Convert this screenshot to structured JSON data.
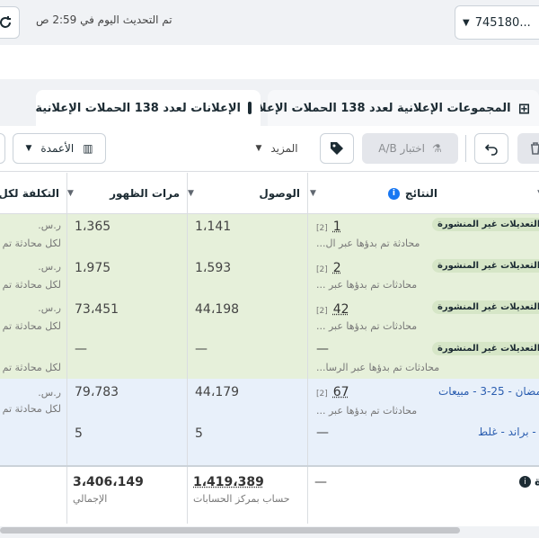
{
  "header": {
    "updated_text": "تم التحديث اليوم في 2:59 ص",
    "account_label": "745180..."
  },
  "tabs": {
    "ads": "الإعلانات لعدد 138 الحملات الإعلانية",
    "adsets": "المجموعات الإعلانية لعدد 138 الحملات الإعلانية"
  },
  "toolbar": {
    "ab_test": "اختبار A/B",
    "more": "المزيد",
    "columns": "الأعمدة"
  },
  "columns": {
    "results": "النتائج",
    "reach": "الوصول",
    "impressions": "مرات الظهور",
    "cost": "التكلفة لكل نتي"
  },
  "badge_text": "التعديلات غير المنشورة",
  "rows": [
    {
      "result": "1",
      "result_sub": "محادثة تم بدؤها عبر ال...",
      "reach": "1،141",
      "impressions": "1،365",
      "cost": "ر.س.",
      "cost_sub": "لكل محادثة تم بد"
    },
    {
      "result": "2",
      "result_sub": "محادثات تم بدؤها عبر ...",
      "reach": "1،593",
      "impressions": "1،975",
      "cost": "ر.س.",
      "cost_sub": "لكل محادثة تم بد"
    },
    {
      "result": "42",
      "result_sub": "محادثات تم بدؤها عبر ...",
      "reach": "44،198",
      "impressions": "73،451",
      "cost": "ر.س.",
      "cost_sub": "لكل محادثة تم بد"
    },
    {
      "result": "—",
      "result_sub": "محادثات تم بدؤها عبر الرسا...",
      "reach": "—",
      "impressions": "—",
      "cost": "",
      "cost_sub": "لكل محادثة تم بد"
    },
    {
      "result": "67",
      "result_sub": "محادثات تم بدؤها عبر ...",
      "reach": "44،179",
      "impressions": "79،783",
      "cost": "ر.س.",
      "cost_sub": "لكل محادثة تم بد",
      "name": "رمضان - 25-3 - مبيعات"
    },
    {
      "result": "—",
      "reach": "5",
      "impressions": "5",
      "name": "3 - براند - غلط"
    }
  ],
  "totals": {
    "result": "—",
    "reach": "1،419،389",
    "reach_sub": "حساب بمركز الحسابات",
    "impressions": "3،406،149",
    "impressions_sub": "الإجمالي",
    "label": "ة"
  },
  "footnote_tag": "[2]"
}
